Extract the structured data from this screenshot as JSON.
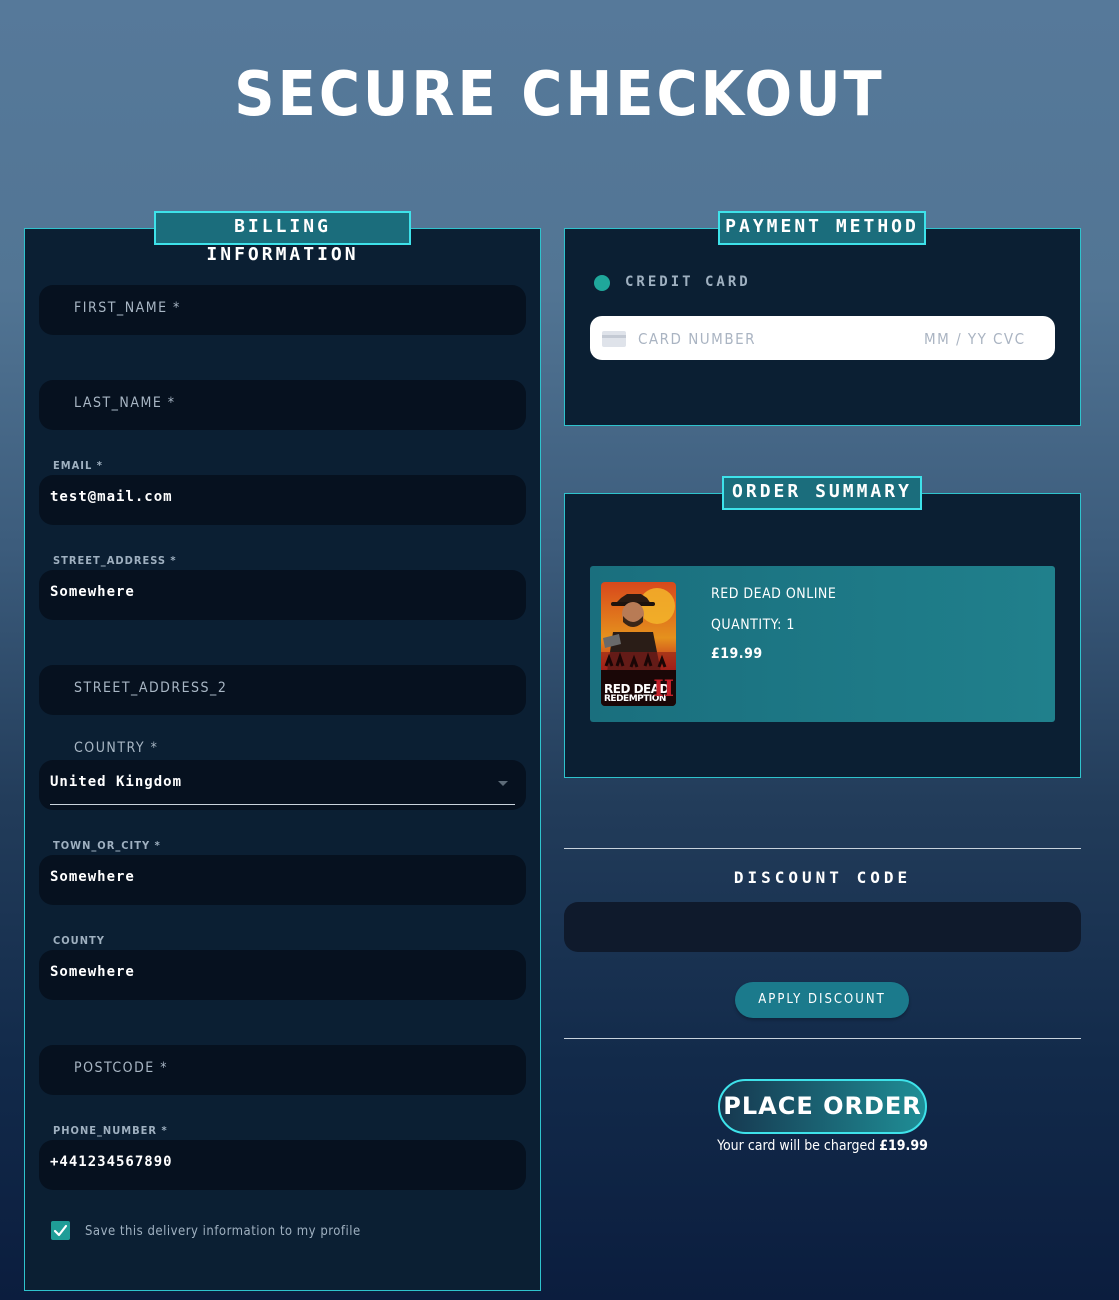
{
  "page": {
    "title": "SECURE CHECKOUT"
  },
  "billing": {
    "heading": "BILLING INFORMATION",
    "first_name_placeholder": "FIRST_NAME *",
    "last_name_placeholder": "LAST_NAME *",
    "email_label": "EMAIL *",
    "email_value": "test@mail.com",
    "street_label": "STREET_ADDRESS *",
    "street_value": "Somewhere",
    "street2_placeholder": "STREET_ADDRESS_2",
    "country_label": "COUNTRY *",
    "country_value": "United Kingdom",
    "town_label": "TOWN_OR_CITY *",
    "town_value": "Somewhere",
    "county_label": "COUNTY",
    "county_value": "Somewhere",
    "postcode_placeholder": "POSTCODE *",
    "phone_label": "PHONE_NUMBER *",
    "phone_value": "+441234567890",
    "save_checked": true,
    "save_label": "Save this delivery information to my profile"
  },
  "payment": {
    "heading": "PAYMENT METHOD",
    "method_label": "CREDIT CARD",
    "card_number_placeholder": "CARD NUMBER",
    "expiry_placeholder": "MM / YY",
    "cvc_placeholder": "CVC"
  },
  "order": {
    "heading": "ORDER SUMMARY",
    "item": {
      "name": "RED DEAD ONLINE",
      "quantity": "QUANTITY: 1",
      "price": "£19.99",
      "cover_title_line1": "RED DEAD",
      "cover_title_line2": "REDEMPTION",
      "cover_numeral": "II"
    }
  },
  "discount": {
    "title": "DISCOUNT CODE",
    "input_value": "",
    "apply_label": "APPLY DISCOUNT"
  },
  "checkout": {
    "place_order_label": "PLACE ORDER",
    "charge_prefix": "Your card will be charged",
    "charge_amount": "£19.99"
  },
  "colors": {
    "accent": "#3ee2ea",
    "panel_bg": "#0b1f33",
    "field_bg": "#06111f",
    "checkbox": "#1f9d97"
  }
}
